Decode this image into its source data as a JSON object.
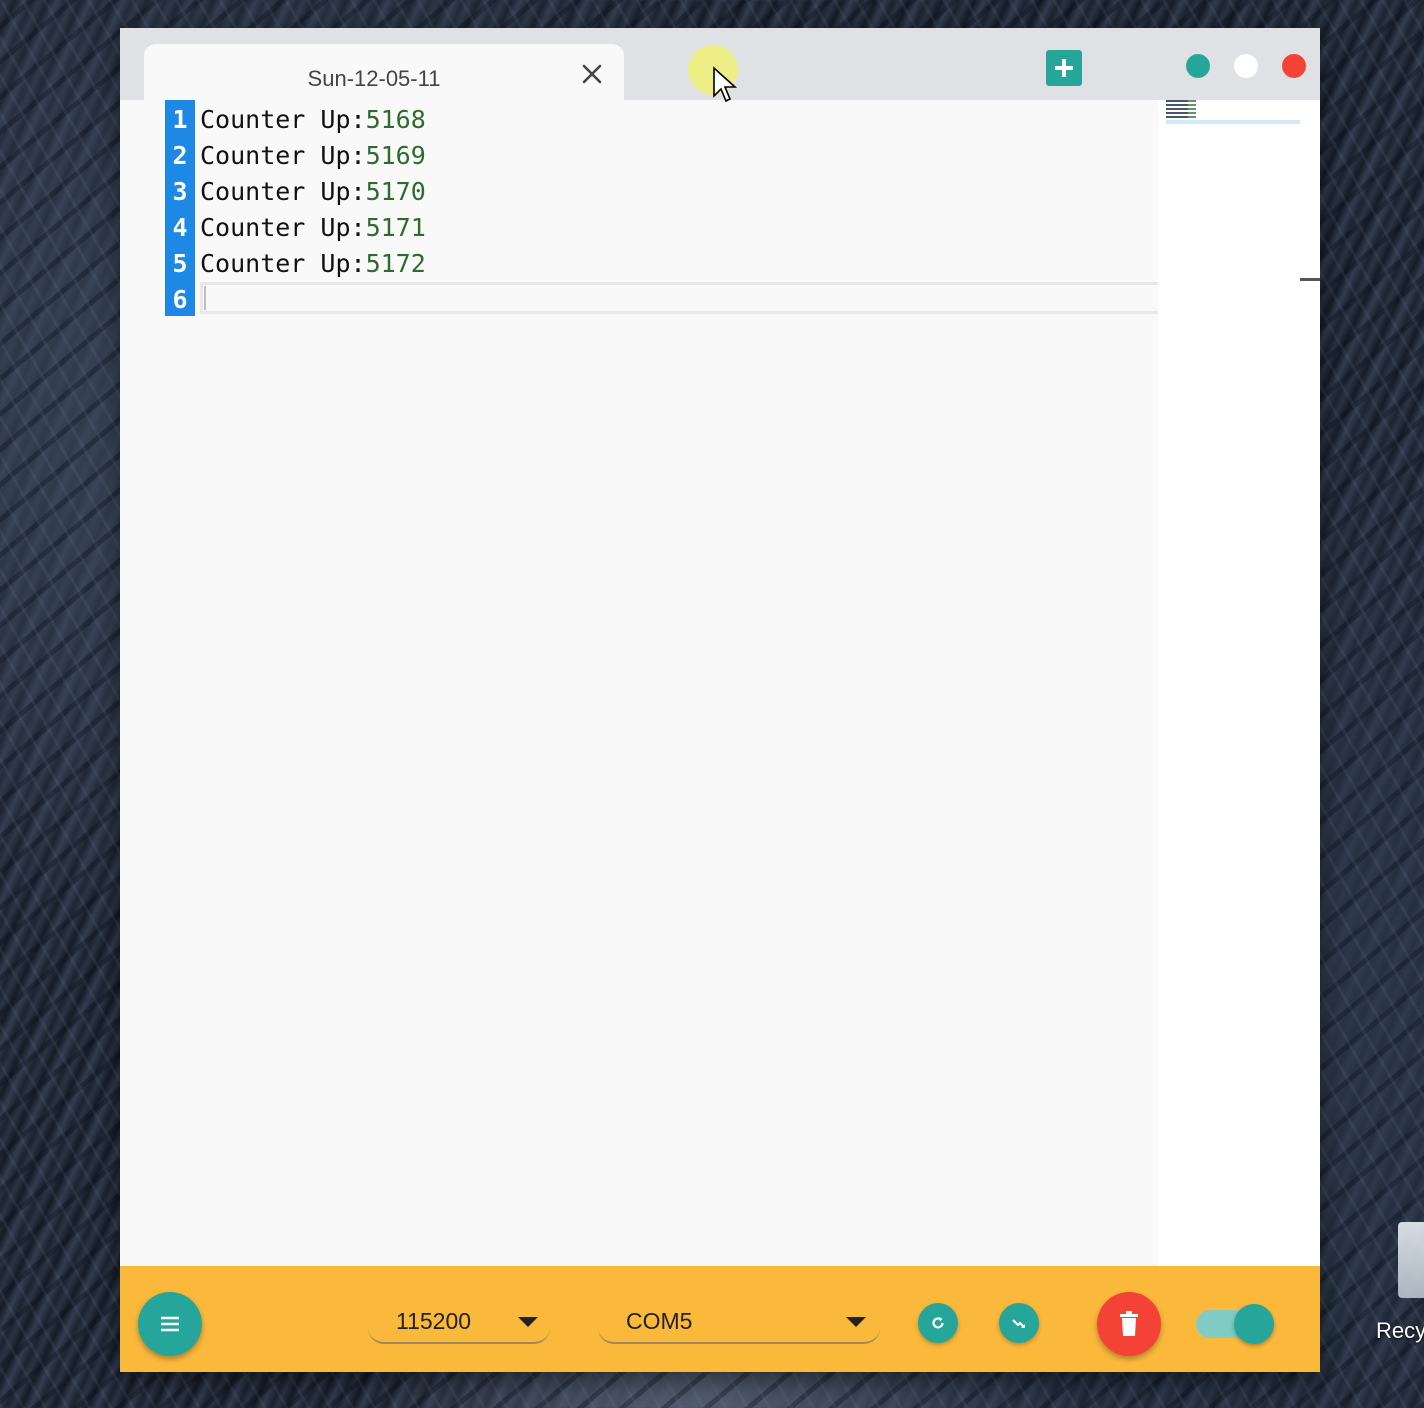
{
  "tab": {
    "title": "Sun-12-05-11"
  },
  "editor": {
    "lines": [
      {
        "number": "1",
        "label": "Counter Up:",
        "value": "5168"
      },
      {
        "number": "2",
        "label": "Counter Up:",
        "value": "5169"
      },
      {
        "number": "3",
        "label": "Counter Up:",
        "value": "5170"
      },
      {
        "number": "4",
        "label": "Counter Up:",
        "value": "5171"
      },
      {
        "number": "5",
        "label": "Counter Up:",
        "value": "5172"
      },
      {
        "number": "6",
        "label": "",
        "value": ""
      }
    ]
  },
  "toolbar": {
    "baud_rate": "115200",
    "port": "COM5",
    "connection_toggle_on": true
  },
  "desktop": {
    "recycle_bin_label": "Recy"
  },
  "colors": {
    "accent": "#26a69a",
    "toolbar": "#fbb93c",
    "danger": "#f44336",
    "gutter": "#1e88e5"
  },
  "icons": {
    "add_tab": "plus-icon",
    "close_tab": "close-icon",
    "menu": "hamburger-icon",
    "refresh": "refresh-icon",
    "connect": "connect-icon",
    "clear": "trash-icon"
  }
}
